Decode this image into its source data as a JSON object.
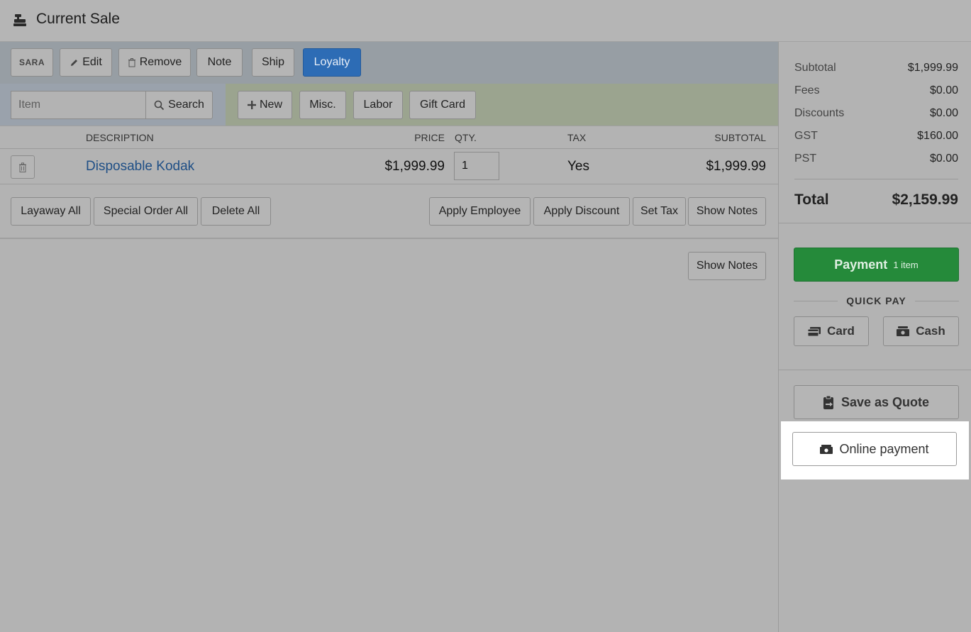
{
  "header": {
    "title": "Current Sale",
    "icon": "cash-register-icon"
  },
  "customer_bar": {
    "customer_code": "SARA",
    "edit_label": "Edit",
    "remove_label": "Remove",
    "note_label": "Note",
    "ship_label": "Ship",
    "loyalty_label": "Loyalty"
  },
  "item_bar": {
    "item_placeholder": "Item",
    "search_label": "Search",
    "new_label": "New",
    "misc_label": "Misc.",
    "labor_label": "Labor",
    "gift_card_label": "Gift Card"
  },
  "table": {
    "columns": {
      "description": "DESCRIPTION",
      "price": "PRICE",
      "qty": "QTY.",
      "tax": "TAX",
      "subtotal": "SUBTOTAL"
    },
    "rows": [
      {
        "description": "Disposable Kodak",
        "price": "$1,999.99",
        "qty": "1",
        "tax": "Yes",
        "subtotal": "$1,999.99"
      }
    ]
  },
  "actions": {
    "layaway_all": "Layaway All",
    "special_order_all": "Special Order All",
    "delete_all": "Delete All",
    "apply_employee": "Apply Employee",
    "apply_discount": "Apply Discount",
    "set_tax": "Set Tax",
    "show_notes": "Show Notes"
  },
  "notes_area": {
    "show_notes": "Show Notes"
  },
  "summary": {
    "subtotal_label": "Subtotal",
    "subtotal": "$1,999.99",
    "fees_label": "Fees",
    "fees": "$0.00",
    "discounts_label": "Discounts",
    "discounts": "$0.00",
    "gst_label": "GST",
    "gst": "$160.00",
    "pst_label": "PST",
    "pst": "$0.00",
    "total_label": "Total",
    "total": "$2,159.99"
  },
  "payment": {
    "payment_label": "Payment",
    "item_count": "1 item",
    "quick_pay_label": "QUICK PAY",
    "card_label": "Card",
    "cash_label": "Cash",
    "save_quote_label": "Save as Quote",
    "online_payment_label": "Online payment"
  },
  "colors": {
    "loyalty_blue": "#2d6cb5",
    "payment_green": "#258a3a",
    "link_blue": "#1f4f86"
  }
}
